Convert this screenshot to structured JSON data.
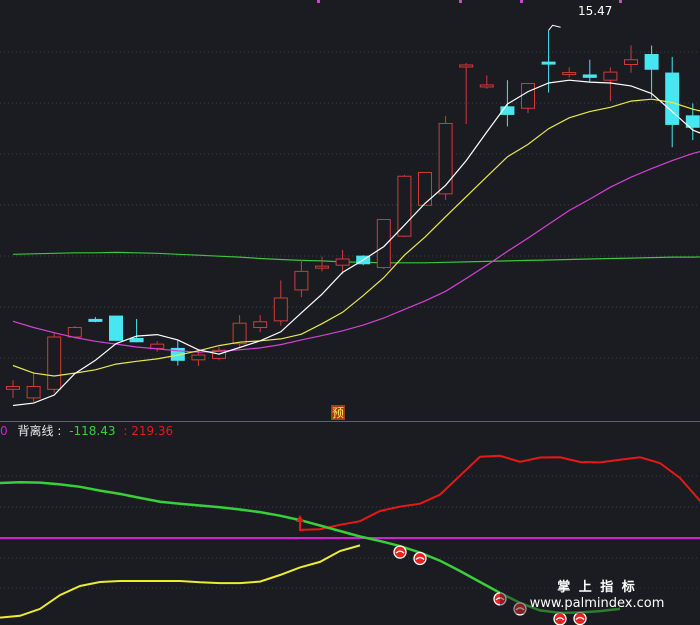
{
  "chart_data": [
    {
      "type": "candlestick",
      "title": "",
      "annotations": {
        "high_label": "15.47",
        "marker_char": "预"
      },
      "ylim": [
        7.6,
        16.2
      ],
      "grid": true,
      "colors": {
        "up": "#d23a3a",
        "down": "#48e6f0",
        "ma_fast": "#ffffff",
        "ma_mid": "#e8e84a",
        "ma_slow": "#d640d6",
        "ma_long": "#3cc43c"
      },
      "candles": [
        {
          "o": 8.14,
          "h": 8.33,
          "l": 7.96,
          "c": 8.2
        },
        {
          "o": 7.96,
          "h": 8.5,
          "l": 7.88,
          "c": 8.2
        },
        {
          "o": 8.14,
          "h": 9.34,
          "l": 8.07,
          "c": 9.24
        },
        {
          "o": 9.24,
          "h": 9.47,
          "l": 9.21,
          "c": 9.44
        },
        {
          "o": 9.61,
          "h": 9.66,
          "l": 9.55,
          "c": 9.6
        },
        {
          "o": 9.68,
          "h": 9.68,
          "l": 9.16,
          "c": 9.17
        },
        {
          "o": 9.21,
          "h": 9.62,
          "l": 9.13,
          "c": 9.14
        },
        {
          "o": 9.0,
          "h": 9.15,
          "l": 8.93,
          "c": 9.09
        },
        {
          "o": 9.0,
          "h": 9.18,
          "l": 8.64,
          "c": 8.75
        },
        {
          "o": 8.76,
          "h": 8.97,
          "l": 8.63,
          "c": 8.86
        },
        {
          "o": 8.79,
          "h": 9.03,
          "l": 8.75,
          "c": 8.96
        },
        {
          "o": 9.1,
          "h": 9.7,
          "l": 9.0,
          "c": 9.53
        },
        {
          "o": 9.44,
          "h": 9.7,
          "l": 9.34,
          "c": 9.56
        },
        {
          "o": 9.58,
          "h": 10.43,
          "l": 9.48,
          "c": 10.06
        },
        {
          "o": 10.23,
          "h": 10.86,
          "l": 10.08,
          "c": 10.62
        },
        {
          "o": 10.7,
          "h": 10.93,
          "l": 10.62,
          "c": 10.73
        },
        {
          "o": 10.75,
          "h": 11.07,
          "l": 10.56,
          "c": 10.88
        },
        {
          "o": 10.94,
          "h": 10.96,
          "l": 10.75,
          "c": 10.78
        },
        {
          "o": 10.7,
          "h": 11.64,
          "l": 10.67,
          "c": 11.71
        },
        {
          "o": 11.36,
          "h": 12.65,
          "l": 11.34,
          "c": 12.62
        },
        {
          "o": 12.01,
          "h": 12.69,
          "l": 12.33,
          "c": 12.7
        },
        {
          "o": 12.25,
          "h": 13.89,
          "l": 12.12,
          "c": 13.73
        },
        {
          "o": 14.94,
          "h": 15.0,
          "l": 13.72,
          "c": 14.96
        },
        {
          "o": 14.52,
          "h": 14.74,
          "l": 14.46,
          "c": 14.54
        },
        {
          "o": 14.08,
          "h": 14.64,
          "l": 13.67,
          "c": 13.92
        },
        {
          "o": 14.05,
          "h": 14.55,
          "l": 13.95,
          "c": 14.57
        },
        {
          "o": 15.02,
          "h": 15.69,
          "l": 14.38,
          "c": 15.0
        },
        {
          "o": 14.79,
          "h": 14.91,
          "l": 14.7,
          "c": 14.8
        },
        {
          "o": 14.75,
          "h": 15.07,
          "l": 14.59,
          "c": 14.7
        },
        {
          "o": 14.64,
          "h": 14.91,
          "l": 14.2,
          "c": 14.81
        },
        {
          "o": 14.97,
          "h": 15.37,
          "l": 14.8,
          "c": 15.07
        },
        {
          "o": 15.18,
          "h": 15.37,
          "l": 14.27,
          "c": 14.87
        },
        {
          "o": 14.79,
          "h": 15.13,
          "l": 13.23,
          "c": 13.71
        },
        {
          "o": 13.89,
          "h": 14.15,
          "l": 13.38,
          "c": 13.65
        },
        {
          "o": 13.61,
          "h": 13.98,
          "l": 13.0,
          "c": 13.32
        },
        {
          "o": 13.4,
          "h": 13.42,
          "l": 13.16,
          "c": 13.11
        },
        {
          "o": 13.22,
          "h": 13.36,
          "l": 12.61,
          "c": 12.61
        }
      ],
      "ma_fast": [
        7.8,
        7.85,
        8.02,
        8.47,
        8.75,
        9.1,
        9.26,
        9.29,
        9.18,
        8.97,
        8.88,
        9.02,
        9.16,
        9.35,
        9.75,
        10.14,
        10.6,
        10.86,
        11.14,
        11.59,
        12.05,
        12.43,
        12.95,
        13.55,
        14.14,
        14.4,
        14.58,
        14.64,
        14.6,
        14.58,
        14.52,
        14.36,
        13.98,
        13.59,
        13.42,
        13.2,
        12.95
      ],
      "ma_mid": [
        8.64,
        8.48,
        8.42,
        8.48,
        8.55,
        8.67,
        8.73,
        8.78,
        8.86,
        8.95,
        9.06,
        9.13,
        9.16,
        9.2,
        9.3,
        9.52,
        9.76,
        10.11,
        10.49,
        10.96,
        11.34,
        11.77,
        12.19,
        12.61,
        13.03,
        13.29,
        13.62,
        13.85,
        13.98,
        14.07,
        14.2,
        14.24,
        14.17,
        14.03,
        13.93,
        13.83,
        13.73
      ],
      "ma_slow": [
        9.57,
        9.44,
        9.33,
        9.23,
        9.15,
        9.09,
        9.03,
        8.99,
        8.95,
        8.92,
        8.94,
        8.97,
        9.01,
        9.08,
        9.18,
        9.27,
        9.37,
        9.49,
        9.64,
        9.82,
        10.0,
        10.2,
        10.47,
        10.75,
        11.04,
        11.32,
        11.61,
        11.9,
        12.14,
        12.39,
        12.6,
        12.78,
        12.95,
        13.1,
        13.21,
        13.31,
        13.39
      ],
      "ma_long": [
        10.98,
        10.99,
        11.0,
        11.01,
        11.01,
        11.02,
        11.01,
        11.0,
        10.98,
        10.96,
        10.94,
        10.92,
        10.89,
        10.87,
        10.85,
        10.84,
        10.82,
        10.81,
        10.8,
        10.8,
        10.8,
        10.81,
        10.82,
        10.83,
        10.84,
        10.85,
        10.86,
        10.87,
        10.88,
        10.89,
        10.9,
        10.91,
        10.92,
        10.92,
        10.93,
        10.93,
        10.94
      ],
      "marker_index": 17
    },
    {
      "type": "line",
      "title": "背离线",
      "legend": {
        "prefix": "0",
        "name": "背离线",
        "value1": "-118.43",
        "value2": ": 219.36"
      },
      "ylim": [
        -450,
        550
      ],
      "grid": true,
      "colors": {
        "green": "#38d038",
        "red": "#e81818",
        "yellow": "#eded30",
        "magenta": "#d020d0",
        "legend_label": "#e8e8e8"
      },
      "reference_line": 0,
      "green_line": [
        314,
        318,
        316,
        306,
        293,
        272,
        254,
        232,
        211,
        200,
        190,
        180,
        168,
        154,
        134,
        110,
        80,
        50,
        20,
        -5,
        -33,
        -68,
        -113,
        -170,
        -230,
        -290,
        -345,
        -386,
        -400,
        -398,
        -390,
        -378
      ],
      "upper_line": [
        null,
        null,
        null,
        null,
        null,
        null,
        null,
        null,
        null,
        null,
        null,
        null,
        null,
        null,
        null,
        56,
        60,
        84,
        104,
        160,
        184,
        200,
        250,
        354,
        458,
        463,
        430,
        454,
        455,
        429,
        427,
        442,
        455,
        423,
        341,
        216,
        126,
        79
      ],
      "lower_line": [
        -426,
        -416,
        -378,
        -302,
        -252,
        -230,
        -225,
        -225,
        -225,
        -225,
        -232,
        -236,
        -236,
        -228,
        -192,
        -150,
        -120,
        -60,
        -29
      ],
      "arrow_index": 15,
      "balls_index": [
        20,
        21,
        25,
        26,
        28,
        29
      ]
    }
  ],
  "watermark": {
    "title": "掌 上 指 标",
    "url": "www.palmindex.com"
  }
}
